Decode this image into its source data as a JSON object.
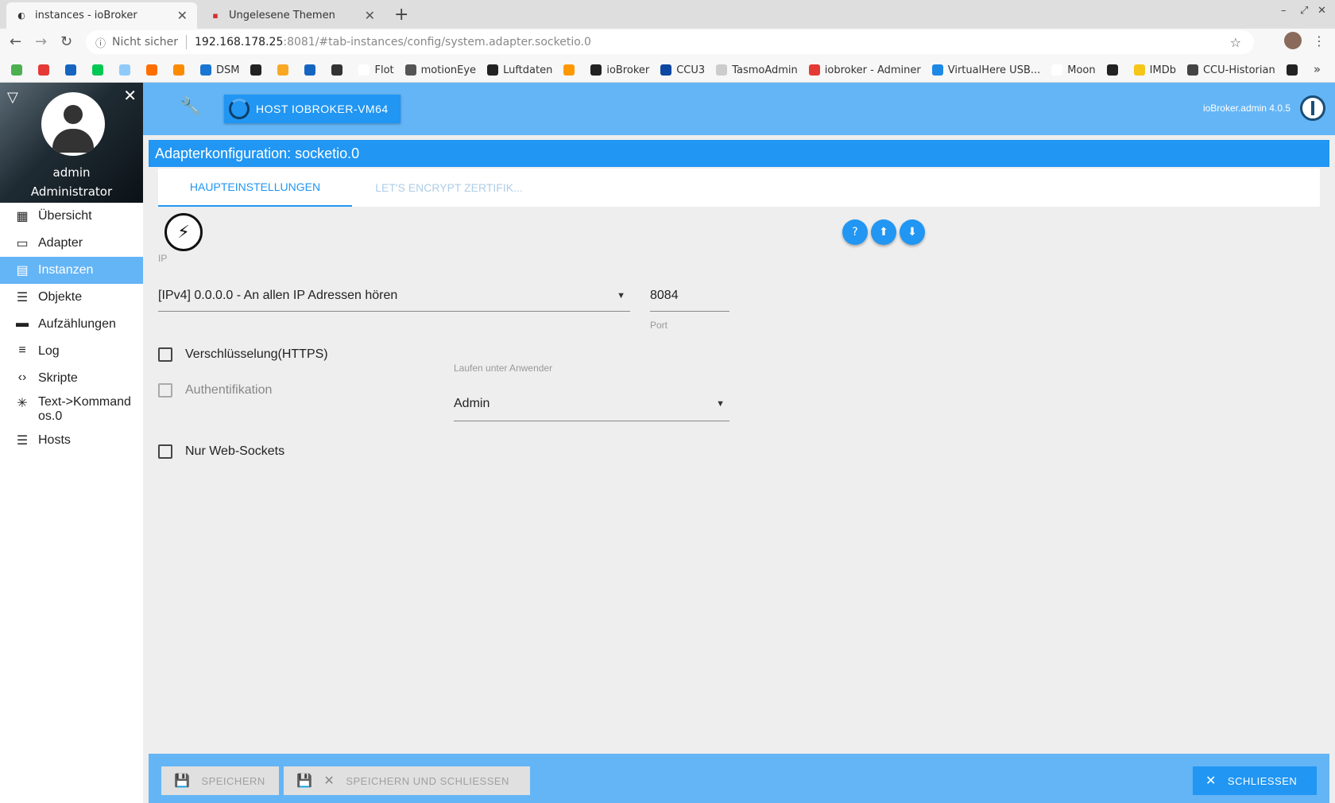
{
  "browser": {
    "tabs": [
      {
        "title": "instances - ioBroker",
        "active": true
      },
      {
        "title": "Ungelesene Themen",
        "active": false
      }
    ],
    "new_tab": "+",
    "window_controls": [
      "–",
      "⤢",
      "✕"
    ],
    "security_label": "Nicht sicher",
    "url_host": "192.168.178.25",
    "url_rest": ":8081/#tab-instances/config/system.adapter.socketio.0",
    "bookmarks": [
      {
        "label": "",
        "color": "#4caf50"
      },
      {
        "label": "",
        "color": "#e53935"
      },
      {
        "label": "",
        "color": "#1565c0"
      },
      {
        "label": "",
        "color": "#00c853"
      },
      {
        "label": "",
        "color": "#90caf9"
      },
      {
        "label": "",
        "color": "#ff6f00"
      },
      {
        "label": "",
        "color": "#fb8c00"
      },
      {
        "label": "DSM",
        "color": "#1976d2"
      },
      {
        "label": "",
        "color": "#222222"
      },
      {
        "label": "",
        "color": "#f9a825"
      },
      {
        "label": "",
        "color": "#1565c0"
      },
      {
        "label": "",
        "color": "#333333"
      },
      {
        "label": "Flot",
        "color": "#ffffff"
      },
      {
        "label": "motionEye",
        "color": "#555555"
      },
      {
        "label": "Luftdaten",
        "color": "#222222"
      },
      {
        "label": "",
        "color": "#ff9800"
      },
      {
        "label": "ioBroker",
        "color": "#222222"
      },
      {
        "label": "CCU3",
        "color": "#0d47a1"
      },
      {
        "label": "TasmoAdmin",
        "color": "#cccccc"
      },
      {
        "label": "iobroker - Adminer",
        "color": "#e53935"
      },
      {
        "label": "VirtualHere USB...",
        "color": "#1e88e5"
      },
      {
        "label": "Moon",
        "color": "#ffffff"
      },
      {
        "label": "",
        "color": "#222222"
      },
      {
        "label": "IMDb",
        "color": "#f5c518"
      },
      {
        "label": "CCU-Historian",
        "color": "#444444"
      },
      {
        "label": "",
        "color": "#222222"
      }
    ],
    "more": "»"
  },
  "sidebar": {
    "username": "admin",
    "role": "Administrator",
    "items": [
      {
        "label": "Übersicht",
        "icon": "apps-icon",
        "glyph": "▦",
        "active": false
      },
      {
        "label": "Adapter",
        "icon": "store-icon",
        "glyph": "▭",
        "active": false
      },
      {
        "label": "Instanzen",
        "icon": "instances-icon",
        "glyph": "▤",
        "active": true
      },
      {
        "label": "Objekte",
        "icon": "list-icon",
        "glyph": "☰",
        "active": false
      },
      {
        "label": "Aufzählungen",
        "icon": "enum-icon",
        "glyph": "▬",
        "active": false
      },
      {
        "label": "Log",
        "icon": "log-icon",
        "glyph": "≡",
        "active": false
      },
      {
        "label": "Skripte",
        "icon": "code-icon",
        "glyph": "‹›",
        "active": false
      },
      {
        "label": "Text->Kommandos.0",
        "icon": "snowflake-icon",
        "glyph": "✳",
        "active": false
      },
      {
        "label": "Hosts",
        "icon": "storage-icon",
        "glyph": "☰",
        "active": false
      }
    ]
  },
  "appbar": {
    "host_button": "HOST IOBROKER-VM64",
    "version": "ioBroker.admin 4.0.5"
  },
  "config": {
    "title": "Adapterkonfiguration: socketio.0",
    "tabs": [
      "HAUPTEINSTELLUNGEN",
      "LET'S ENCRYPT ZERTIFIK..."
    ],
    "ip_label": "IP",
    "ip_value": "[IPv4] 0.0.0.0 - An allen IP Adressen hören",
    "port_value": "8084",
    "port_label": "Port",
    "https_label": "Verschlüsselung(HTTPS)",
    "auth_label": "Authentifikation",
    "user_label": "Laufen unter Anwender",
    "user_value": "Admin",
    "websockets_label": "Nur Web-Sockets"
  },
  "bottom": {
    "save": "SPEICHERN",
    "save_close": "SPEICHERN UND SCHLIESSEN",
    "close": "SCHLIESSEN"
  }
}
